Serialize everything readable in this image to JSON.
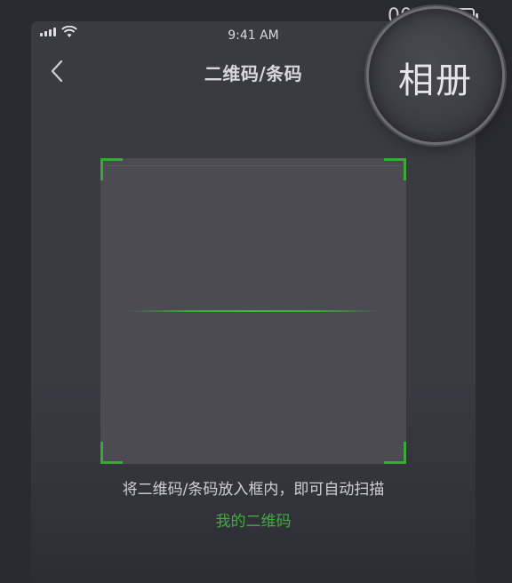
{
  "status_bar": {
    "time": "9:41 AM",
    "battery_text": "00%",
    "signal_icon": "signal-bars-icon",
    "wifi_icon": "wifi-icon"
  },
  "nav": {
    "title": "二维码/条码",
    "back_icon": "chevron-left-icon",
    "album_label": "相册"
  },
  "scanner": {
    "hint": "将二维码/条码放入框内，即可自动扫描",
    "my_qr_link": "我的二维码",
    "accent_color": "#3da83a"
  }
}
